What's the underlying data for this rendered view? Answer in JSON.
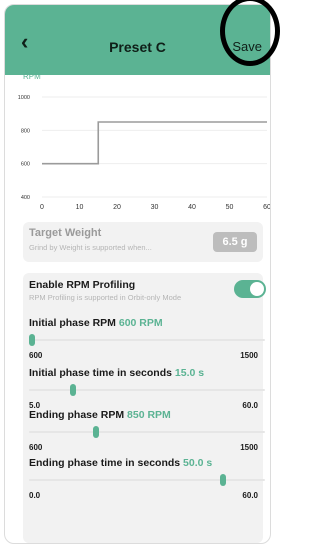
{
  "header": {
    "back_icon": "chevron-left-icon",
    "title": "Preset C",
    "save_label": "Save"
  },
  "chart_data": {
    "type": "line",
    "ylabel": "RPM",
    "xticks": [
      "0",
      "10",
      "20",
      "30",
      "40",
      "50",
      "60"
    ],
    "yticks": [
      "400",
      "600",
      "800",
      "1000"
    ],
    "xlim": [
      0,
      60
    ],
    "ylim": [
      400,
      1000
    ],
    "grid": true,
    "series": [
      {
        "x": [
          0,
          15,
          15,
          60
        ],
        "y": [
          600,
          600,
          850,
          850
        ]
      }
    ]
  },
  "target_weight": {
    "title": "Target Weight",
    "subtitle": "Grind by Weight is supported when...",
    "value": "6.5 g"
  },
  "rpm_profiling": {
    "title": "Enable RPM Profiling",
    "subtitle": "RPM Profiling is supported in Orbit-only Mode",
    "enabled": true
  },
  "sliders": [
    {
      "title": "Initial phase RPM",
      "value": "600 RPM",
      "min": "600",
      "max": "1500",
      "level": 0.0
    },
    {
      "title": "Initial phase time in seconds",
      "value": "15.0 s",
      "min": "5.0",
      "max": "60.0",
      "level": 0.18
    },
    {
      "title": "Ending phase RPM",
      "value": "850 RPM",
      "min": "600",
      "max": "1500",
      "level": 0.28
    },
    {
      "title": "Ending phase time in seconds",
      "value": "50.0 s",
      "min": "0.0",
      "max": "60.0",
      "level": 0.83
    }
  ],
  "colors": {
    "accent": "#5bb393",
    "header_bg": "#5bb393"
  }
}
